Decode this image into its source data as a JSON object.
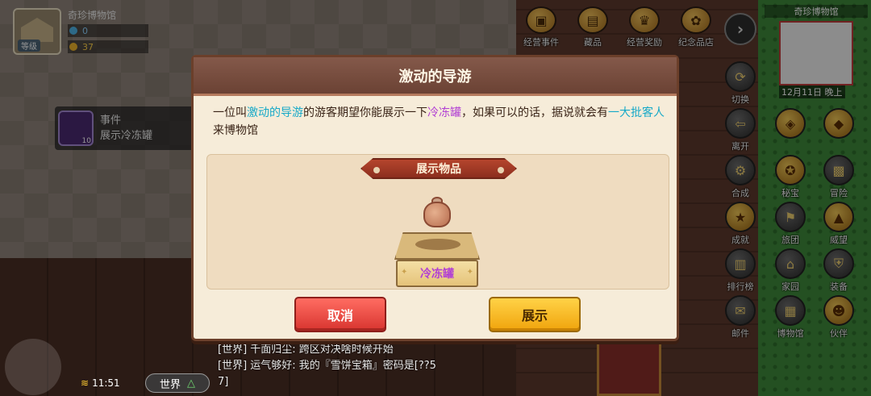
{
  "museum": {
    "name": "奇珍博物馆",
    "level_label": "等级",
    "stat_fans": "0",
    "stat_visitors": "37"
  },
  "event": {
    "title": "事件",
    "description": "展示冷冻罐",
    "badge": "10"
  },
  "top_menu": [
    {
      "label": "经营事件"
    },
    {
      "label": "藏品"
    },
    {
      "label": "经营奖励"
    },
    {
      "label": "纪念品店"
    }
  ],
  "minimap": {
    "title": "奇珍博物馆",
    "footer": "12月11日 晚上"
  },
  "side_left": [
    {
      "label": "切换"
    },
    {
      "label": "离开"
    },
    {
      "label": "合成"
    },
    {
      "label": "成就"
    },
    {
      "label": "排行榜"
    },
    {
      "label": "邮件"
    }
  ],
  "side_right_a": [
    {
      "label": ""
    },
    {
      "label": "秘宝"
    },
    {
      "label": "旅团"
    },
    {
      "label": "家园"
    },
    {
      "label": "博物馆"
    }
  ],
  "side_right_b": [
    {
      "label": ""
    },
    {
      "label": "冒险"
    },
    {
      "label": "威望"
    },
    {
      "label": "装备"
    },
    {
      "label": "伙伴"
    }
  ],
  "chat": {
    "line1": "[世界] 千面归尘: 跨区对决啥时候开始",
    "line2": "[世界] 运气够好: 我的『雪饼宝箱』密码是[??5",
    "line2_wrap": "7]",
    "time": "11:51",
    "channel": "世界"
  },
  "modal": {
    "title": "激动的导游",
    "text": {
      "p1": "一位叫",
      "guide": "激动的导游",
      "p2": "的游客期望你能展示一下",
      "item": "冷冻罐",
      "p3": "，如果可以的话，据说就会有",
      "bonus": "一大批客人",
      "p4": "来博物馆"
    },
    "section_title": "展示物品",
    "item_label": "冷冻罐",
    "cancel_label": "取消",
    "confirm_label": "展示"
  },
  "colors": {
    "highlight_teal": "#17a9c8",
    "highlight_purple": "#b13fd4",
    "cancel": "#d8342f",
    "confirm": "#f0a40c"
  }
}
